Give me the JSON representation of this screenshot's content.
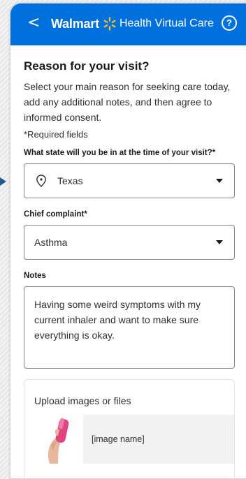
{
  "header": {
    "back_glyph": "<",
    "brand": "Walmart",
    "subtitle": "Health Virtual Care",
    "help_glyph": "?"
  },
  "form": {
    "title": "Reason for your visit?",
    "description": "Select your main reason for seeking care today, add any additional notes, and then agree to informed consent.",
    "required_note": "*Required fields",
    "state_label": "What state will you be in at the time of your visit?*",
    "state_value": "Texas",
    "complaint_label": "Chief complaint*",
    "complaint_value": "Asthma",
    "notes_label": "Notes",
    "notes_value": "Having some weird symptoms with my current inhaler and want to make sure everything is okay.",
    "upload_title": "Upload images or files",
    "file_name": "[image name]"
  },
  "colors": {
    "header_bg": "#0071dc",
    "spark": "#ffc220",
    "text": "#2e2f32"
  },
  "icons": {
    "back": "chevron-left-icon",
    "brand": "walmart-spark-icon",
    "help": "help-circle-icon",
    "location": "location-pin-icon",
    "dropdown": "caret-down-icon"
  }
}
